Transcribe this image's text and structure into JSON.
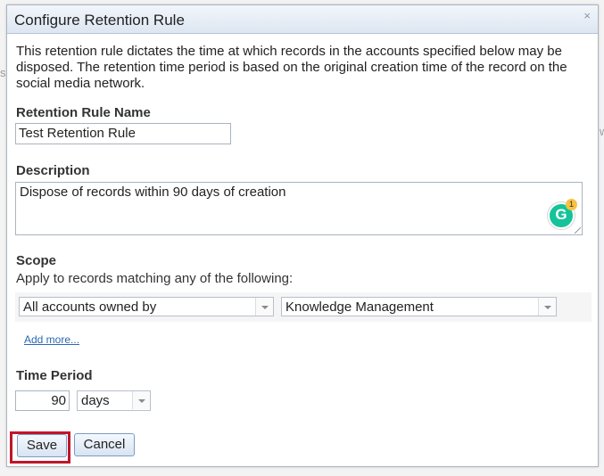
{
  "dialog": {
    "title": "Configure Retention Rule",
    "close_glyph": "×",
    "description": "This retention rule dictates the time at which records in the accounts specified below may be disposed. The retention time period is based on the original creation time of the record on the social media network."
  },
  "rule_name": {
    "label": "Retention Rule Name",
    "value": "Test Retention Rule"
  },
  "description_field": {
    "label": "Description",
    "value": "Dispose of records within 90 days of creation",
    "grammarly_letter": "G",
    "grammarly_count": "1"
  },
  "scope": {
    "label": "Scope",
    "subtitle": "Apply to records matching any of the following:",
    "criteria_select": "All accounts owned by",
    "owner_select": "Knowledge Management",
    "add_more": "Add more..."
  },
  "time_period": {
    "label": "Time Period",
    "value": "90",
    "unit": "days"
  },
  "buttons": {
    "save": "Save",
    "cancel": "Cancel"
  },
  "colors": {
    "highlight": "#c0152a",
    "link": "#2b67b3",
    "grammarly": "#15c39a"
  }
}
